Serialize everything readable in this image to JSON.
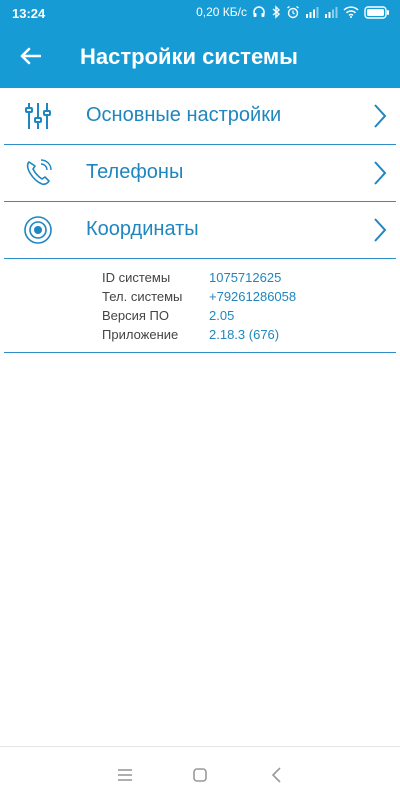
{
  "status_bar": {
    "time": "13:24",
    "network_rate": "0,20 КБ/с",
    "icons": [
      "headphones-icon",
      "bluetooth-icon",
      "alarm-icon",
      "signal-icon",
      "signal-icon",
      "wifi-icon",
      "battery-icon"
    ]
  },
  "app_bar": {
    "title": "Настройки системы",
    "back_icon": "arrow-left-icon"
  },
  "menu": {
    "items": [
      {
        "label": "Основные настройки",
        "icon": "sliders-icon"
      },
      {
        "label": "Телефоны",
        "icon": "phone-icon"
      },
      {
        "label": "Координаты",
        "icon": "location-target-icon"
      }
    ]
  },
  "info": {
    "rows": [
      {
        "label": "ID системы",
        "value": "1075712625"
      },
      {
        "label": "Тел. системы",
        "value": "+79261286058"
      },
      {
        "label": "Версия ПО",
        "value": "2.05"
      },
      {
        "label": "Приложение",
        "value": "2.18.3 (676)"
      }
    ]
  },
  "colors": {
    "accent": "#169bd5",
    "label_text": "#1f86bf",
    "divider": "#2e8fc8"
  }
}
